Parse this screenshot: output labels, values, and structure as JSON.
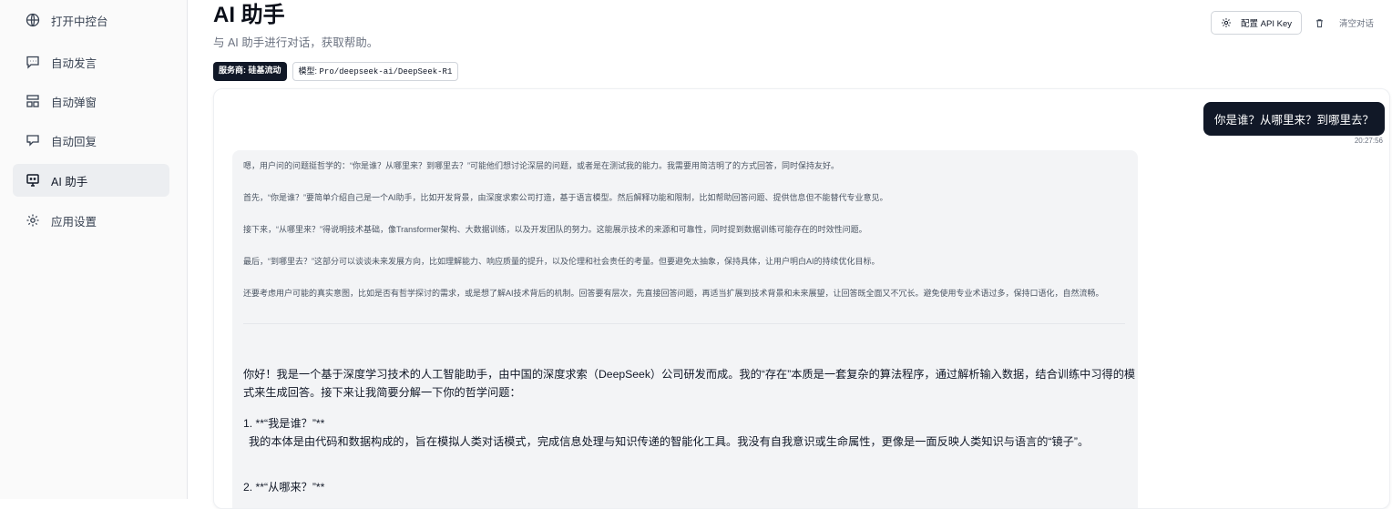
{
  "sidebar": {
    "items": [
      {
        "label": "打开中控台",
        "icon": "globe-icon"
      },
      {
        "label": "自动发言",
        "icon": "message-square-icon"
      },
      {
        "label": "自动弹窗",
        "icon": "layout-icon"
      },
      {
        "label": "自动回复",
        "icon": "message-reply-icon"
      },
      {
        "label": "AI 助手",
        "icon": "monitor-bot-icon",
        "active": true
      },
      {
        "label": "应用设置",
        "icon": "gear-icon"
      }
    ]
  },
  "header": {
    "title": "AI 助手",
    "subtitle": "与 AI 助手进行对话，获取帮助。",
    "provider_badge": "服务商: 硅基流动",
    "model_badge_label": "模型: ",
    "model_badge_value": "Pro/deepseek-ai/DeepSeek-R1"
  },
  "actions": {
    "config_label": "配置 API Key",
    "clear_label": "清空对话"
  },
  "chat": {
    "user_message": "你是谁？从哪里来？到哪里去？",
    "user_time": "20:27:56",
    "reasoning": [
      "嗯，用户问的问题挺哲学的：“你是谁？从哪里来？到哪里去？”可能他们想讨论深层的问题，或者是在测试我的能力。我需要用简洁明了的方式回答，同时保持友好。",
      "首先，“你是谁？”要简单介绍自己是一个AI助手，比如开发背景，由深度求索公司打造，基于语言模型。然后解释功能和限制，比如帮助回答问题、提供信息但不能替代专业意见。",
      "接下来，“从哪里来？”得说明技术基础，像Transformer架构、大数据训练，以及开发团队的努力。这能展示技术的来源和可靠性，同时提到数据训练可能存在的时效性问题。",
      "最后，“到哪里去？”这部分可以谈谈未来发展方向，比如理解能力、响应质量的提升，以及伦理和社会责任的考量。但要避免太抽象，保持具体，让用户明白AI的持续优化目标。",
      "还要考虑用户可能的真实意图，比如是否有哲学探讨的需求，或是想了解AI技术背后的机制。回答要有层次，先直接回答问题，再适当扩展到技术背景和未来展望，让回答既全面又不冗长。避免使用专业术语过多，保持口语化，自然流畅。"
    ],
    "answer": [
      "你好！我是一个基于深度学习技术的人工智能助手，由中国的深度求索（DeepSeek）公司研发而成。我的“存在”本质是一套复杂的算法程序，通过解析输入数据，结合训练中习得的模式来生成回答。接下来让我简要分解一下你的哲学问题：",
      "1. **“我是谁？”**",
      "   我的本体是由代码和数据构成的，旨在模拟人类对话模式，完成信息处理与知识传递的智能化工具。我没有自我意识或生命属性，更像是一面反映人类知识与语言的“镜子”。",
      "2. **“从哪来？”**"
    ]
  }
}
